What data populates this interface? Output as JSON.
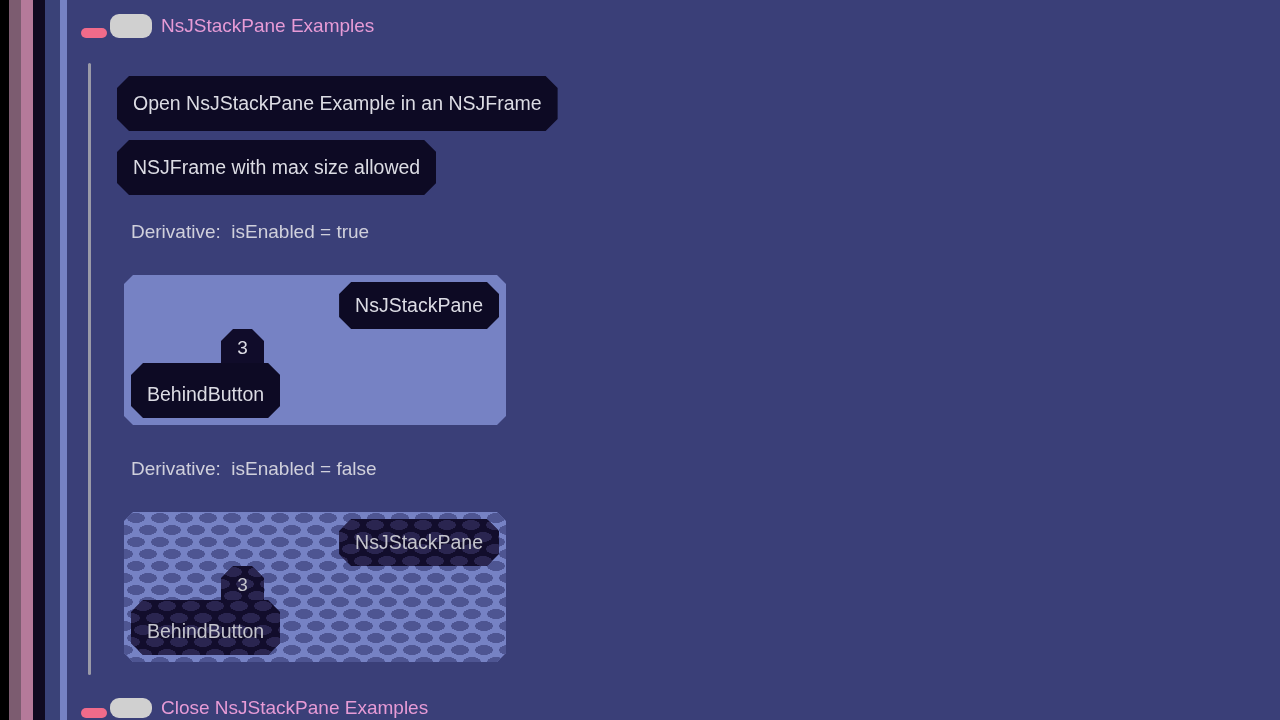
{
  "section_header": {
    "label": "NsJStackPane Examples",
    "on": true
  },
  "buttons": [
    {
      "label": "Open NsJStackPane Example in an NSJFrame"
    },
    {
      "label": "NSJFrame with max size allowed"
    }
  ],
  "derivatives": [
    {
      "label": "Derivative:  isEnabled = true",
      "enabled": true,
      "stack_pane": {
        "front_button": "NsJStackPane",
        "behind_button": "BehindButton",
        "badge": "3"
      }
    },
    {
      "label": "Derivative:  isEnabled = false",
      "enabled": false,
      "stack_pane": {
        "front_button": "NsJStackPane",
        "behind_button": "BehindButton",
        "badge": "3"
      }
    }
  ],
  "section_footer": {
    "label": "Close NsJStackPane Examples",
    "on": true
  }
}
